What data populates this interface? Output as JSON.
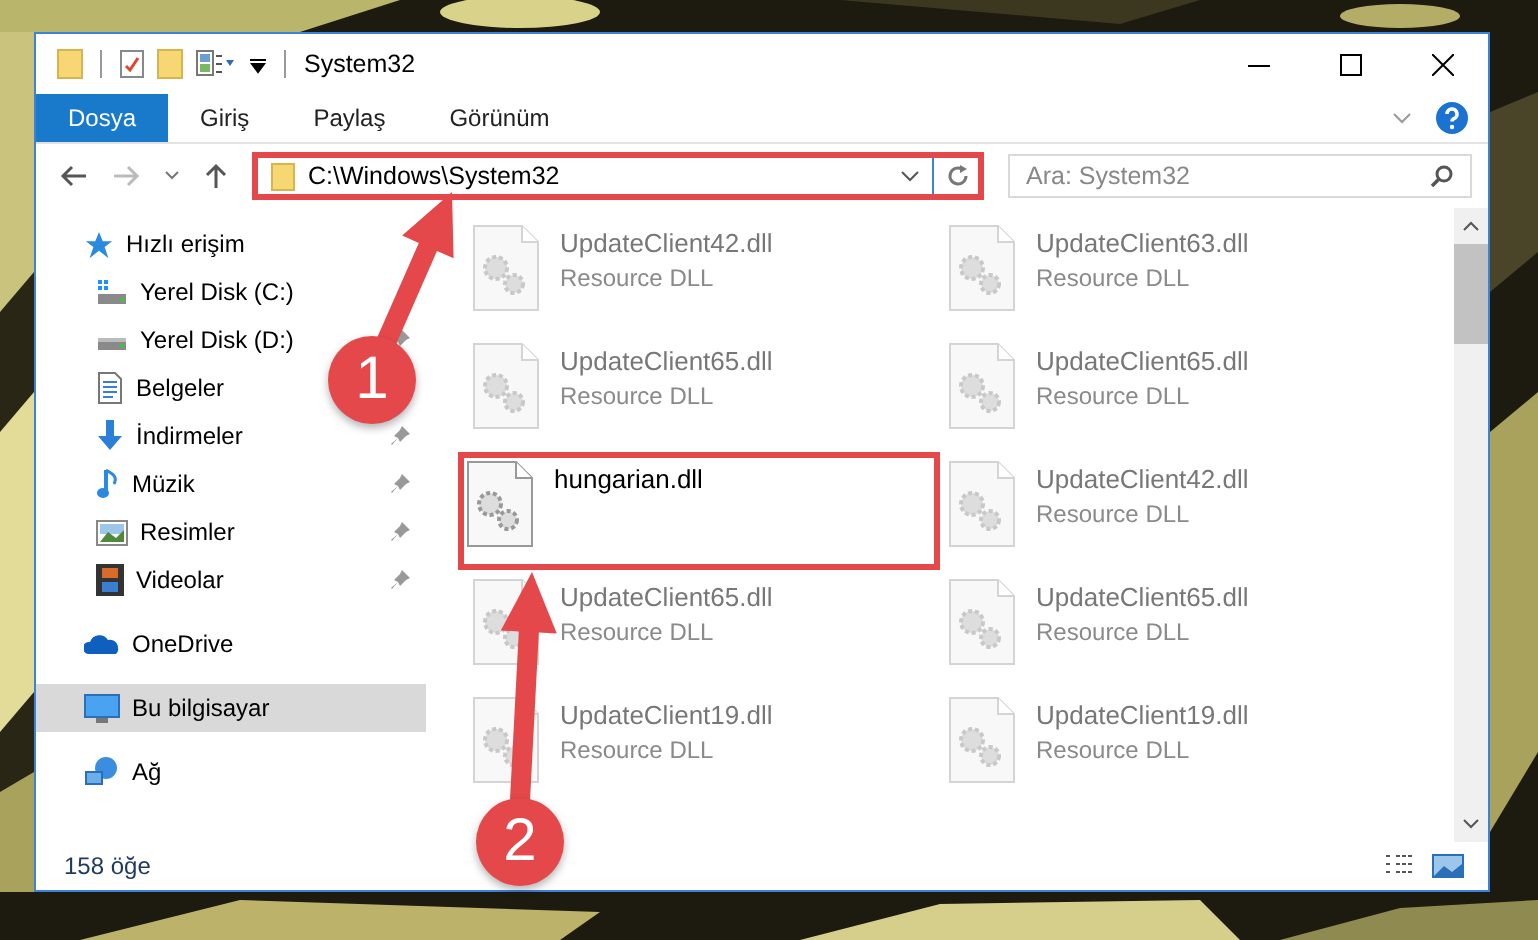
{
  "window": {
    "title": "System32"
  },
  "ribbon_tabs": [
    {
      "label": "Dosya",
      "selected": true
    },
    {
      "label": "Giriş",
      "selected": false
    },
    {
      "label": "Paylaş",
      "selected": false
    },
    {
      "label": "Görünüm",
      "selected": false
    }
  ],
  "address": {
    "value": "C:\\Windows\\System32",
    "highlighted": true
  },
  "search": {
    "placeholder": "Ara: System32"
  },
  "sidebar": {
    "items": [
      {
        "label": "Hızlı erişim",
        "selected": false,
        "children": [
          {
            "label": "Yerel Disk (C:)",
            "selected": false,
            "pinned": false
          },
          {
            "label": "Yerel Disk (D:)",
            "selected": false,
            "pinned": true
          },
          {
            "label": "Belgeler",
            "selected": false
          },
          {
            "label": "İndirmeler",
            "selected": false,
            "pinned": true
          },
          {
            "label": "Müzik",
            "selected": false,
            "pinned": true
          },
          {
            "label": "Resimler",
            "selected": false,
            "pinned": true
          },
          {
            "label": "Videolar",
            "selected": false,
            "pinned": true
          }
        ]
      },
      {
        "label": "OneDrive",
        "selected": false
      },
      {
        "label": "Bu bilgisayar",
        "selected": true
      },
      {
        "label": "Ağ",
        "selected": false
      }
    ]
  },
  "files": [
    {
      "name": "UpdateClient42.dll",
      "type": "Resource DLL",
      "blurred": true,
      "highlighted": false
    },
    {
      "name": "UpdateClient63.dll",
      "type": "Resource DLL",
      "blurred": true,
      "highlighted": false
    },
    {
      "name": "UpdateClient65.dll",
      "type": "Resource DLL",
      "blurred": true,
      "highlighted": false
    },
    {
      "name": "UpdateClient65.dll",
      "type": "Resource DLL",
      "blurred": true,
      "highlighted": false
    },
    {
      "name": "hungarian.dll",
      "blurred": false,
      "highlighted": true
    },
    {
      "name": "UpdateClient42.dll",
      "type": "Resource DLL",
      "blurred": true,
      "highlighted": false
    },
    {
      "name": "UpdateClient65.dll",
      "type": "Resource DLL",
      "blurred": true,
      "highlighted": false
    },
    {
      "name": "UpdateClient65.dll",
      "type": "Resource DLL",
      "blurred": true,
      "highlighted": false
    },
    {
      "name": "UpdateClient19.dll",
      "type": "Resource DLL",
      "blurred": true,
      "highlighted": false
    },
    {
      "name": "UpdateClient19.dll",
      "type": "Resource DLL",
      "blurred": true,
      "highlighted": false
    }
  ],
  "status_bar": {
    "item_count": "158 öğe"
  },
  "annotations": [
    {
      "label": "1"
    },
    {
      "label": "2"
    }
  ]
}
